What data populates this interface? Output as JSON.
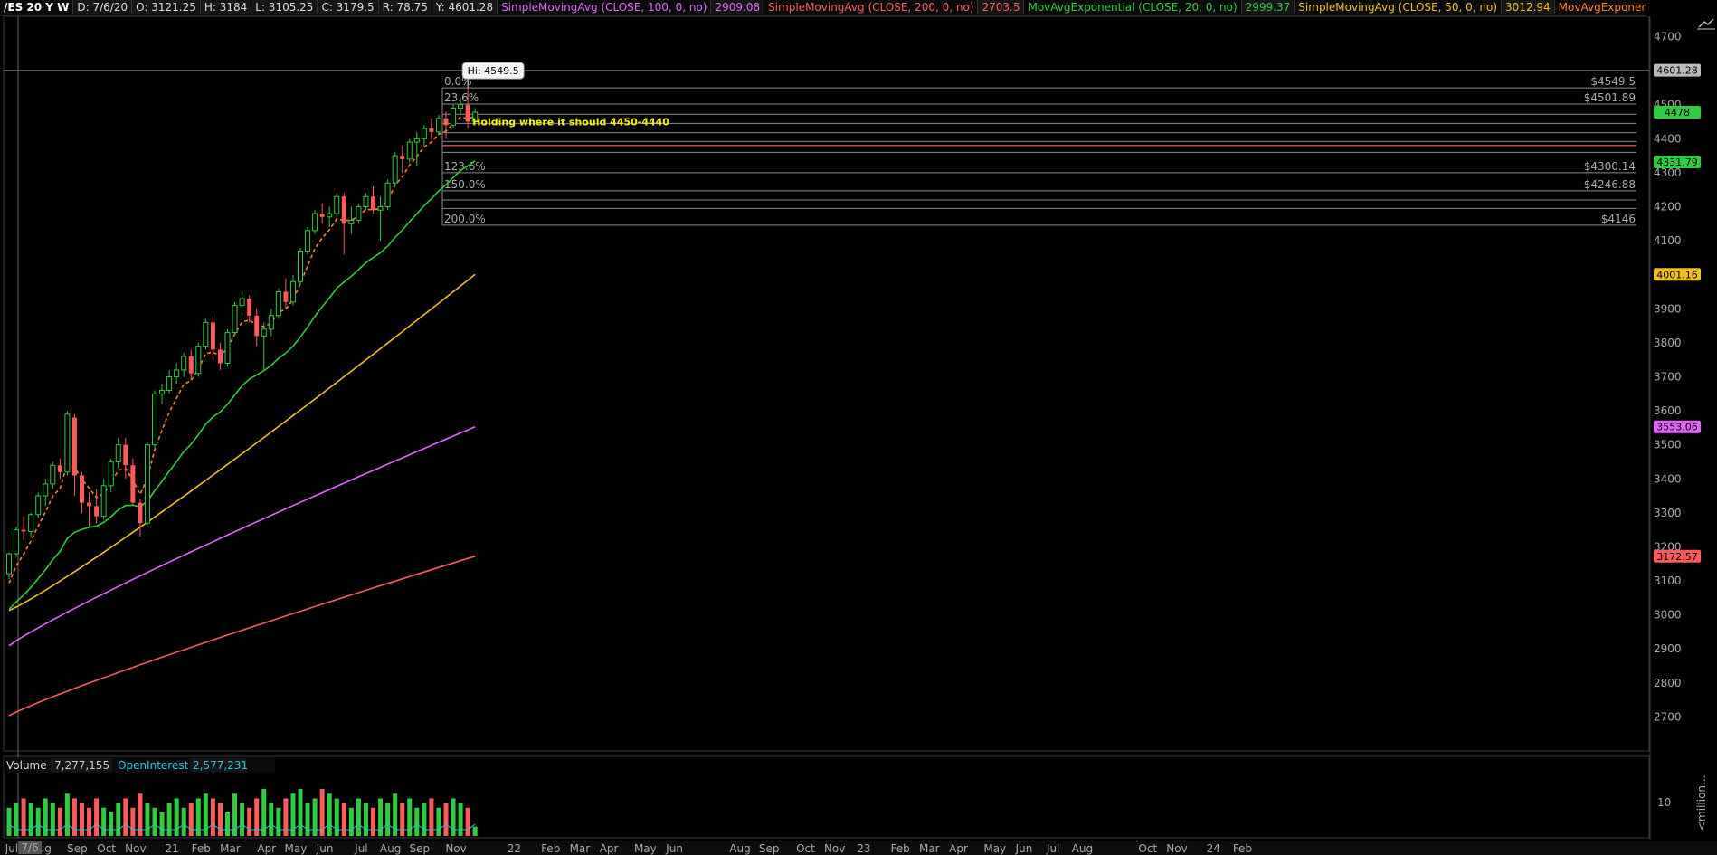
{
  "header": {
    "symbol": "/ES 20 Y W",
    "date": "D: 7/6/20",
    "open": "O: 3121.25",
    "high": "H: 3184",
    "low": "L: 3105.25",
    "close": "C: 3179.5",
    "range": "R: 78.75",
    "y": "Y: 4601.28",
    "studies": [
      {
        "label": "SimpleMovingAvg (CLOSE, 100, 0, no)",
        "value": "2909.08",
        "color": "#e066ff"
      },
      {
        "label": "SimpleMovingAvg (CLOSE, 200, 0, no)",
        "value": "2703.5",
        "color": "#ff5a5a"
      },
      {
        "label": "MovAvgExponential (CLOSE, 20, 0, no)",
        "value": "2999.37",
        "color": "#2ecc40"
      },
      {
        "label": "SimpleMovingAvg (CLOSE, 50, 0, no)",
        "value": "3012.94",
        "color": "#f0c020"
      },
      {
        "label": "MovAvgExponential (CLOSE...",
        "value": "",
        "color": "#ff7f2a"
      }
    ]
  },
  "chart_data": {
    "type": "candlestick",
    "ylim": [
      2600,
      4760
    ],
    "y_ticks": [
      2700,
      2800,
      2900,
      3000,
      3100,
      3200,
      3300,
      3400,
      3500,
      3600,
      3700,
      3800,
      3900,
      4000,
      4100,
      4200,
      4300,
      4400,
      4500,
      4600,
      4700
    ],
    "x_labels": [
      "Jul",
      "Aug",
      "Sep",
      "Oct",
      "Nov",
      "21",
      "Feb",
      "Mar",
      "Apr",
      "May",
      "Jun",
      "Jul",
      "Aug",
      "Sep",
      "Nov",
      "22",
      "Feb",
      "Mar",
      "Apr",
      "May",
      "Jun",
      "Aug",
      "Sep",
      "Oct",
      "Nov",
      "23",
      "Feb",
      "Mar",
      "Apr",
      "May",
      "Jun",
      "Jul",
      "Aug",
      "Oct",
      "Nov",
      "24",
      "Feb"
    ],
    "x_label_index": [
      0,
      4,
      9,
      13,
      17,
      22,
      26,
      30,
      35,
      39,
      43,
      48,
      52,
      56,
      61,
      69,
      74,
      78,
      82,
      87,
      91,
      100,
      104,
      109,
      113,
      117,
      122,
      126,
      130,
      135,
      139,
      143,
      147,
      156,
      160,
      165,
      169
    ],
    "cursor_label": "7/6",
    "candles": [
      [
        3121.25,
        3184,
        3105.25,
        3179.5
      ],
      [
        3180,
        3260,
        3170,
        3250
      ],
      [
        3250,
        3290,
        3220,
        3245
      ],
      [
        3245,
        3300,
        3230,
        3295
      ],
      [
        3295,
        3360,
        3285,
        3350
      ],
      [
        3350,
        3400,
        3320,
        3385
      ],
      [
        3385,
        3450,
        3370,
        3440
      ],
      [
        3440,
        3460,
        3400,
        3420
      ],
      [
        3420,
        3600,
        3410,
        3590
      ],
      [
        3580,
        3590,
        3350,
        3410
      ],
      [
        3410,
        3420,
        3300,
        3330
      ],
      [
        3330,
        3360,
        3260,
        3320
      ],
      [
        3320,
        3370,
        3270,
        3290
      ],
      [
        3290,
        3400,
        3280,
        3380
      ],
      [
        3380,
        3460,
        3360,
        3450
      ],
      [
        3450,
        3520,
        3430,
        3500
      ],
      [
        3500,
        3520,
        3400,
        3440
      ],
      [
        3440,
        3460,
        3320,
        3330
      ],
      [
        3330,
        3340,
        3230,
        3270
      ],
      [
        3270,
        3510,
        3260,
        3500
      ],
      [
        3500,
        3660,
        3490,
        3650
      ],
      [
        3650,
        3680,
        3620,
        3660
      ],
      [
        3660,
        3720,
        3650,
        3700
      ],
      [
        3700,
        3740,
        3680,
        3720
      ],
      [
        3720,
        3770,
        3700,
        3760
      ],
      [
        3760,
        3780,
        3690,
        3710
      ],
      [
        3710,
        3800,
        3700,
        3790
      ],
      [
        3790,
        3870,
        3780,
        3860
      ],
      [
        3860,
        3880,
        3750,
        3780
      ],
      [
        3780,
        3800,
        3720,
        3740
      ],
      [
        3740,
        3840,
        3730,
        3830
      ],
      [
        3830,
        3920,
        3820,
        3910
      ],
      [
        3910,
        3950,
        3880,
        3930
      ],
      [
        3930,
        3940,
        3860,
        3880
      ],
      [
        3880,
        3900,
        3790,
        3820
      ],
      [
        3820,
        3860,
        3720,
        3840
      ],
      [
        3840,
        3900,
        3820,
        3880
      ],
      [
        3880,
        3960,
        3870,
        3950
      ],
      [
        3950,
        3990,
        3900,
        3920
      ],
      [
        3920,
        4000,
        3910,
        3980
      ],
      [
        3980,
        4080,
        3970,
        4070
      ],
      [
        4070,
        4140,
        4060,
        4130
      ],
      [
        4130,
        4190,
        4120,
        4180
      ],
      [
        4180,
        4210,
        4150,
        4170
      ],
      [
        4170,
        4200,
        4140,
        4180
      ],
      [
        4180,
        4240,
        4170,
        4230
      ],
      [
        4230,
        4240,
        4060,
        4150
      ],
      [
        4150,
        4200,
        4120,
        4160
      ],
      [
        4160,
        4210,
        4150,
        4200
      ],
      [
        4200,
        4240,
        4190,
        4230
      ],
      [
        4230,
        4260,
        4180,
        4190
      ],
      [
        4190,
        4230,
        4100,
        4200
      ],
      [
        4200,
        4280,
        4190,
        4270
      ],
      [
        4270,
        4360,
        4260,
        4350
      ],
      [
        4350,
        4380,
        4300,
        4340
      ],
      [
        4340,
        4400,
        4330,
        4390
      ],
      [
        4390,
        4420,
        4320,
        4400
      ],
      [
        4400,
        4440,
        4380,
        4430
      ],
      [
        4430,
        4460,
        4400,
        4420
      ],
      [
        4420,
        4470,
        4410,
        4460
      ],
      [
        4460,
        4480,
        4400,
        4440
      ],
      [
        4440,
        4500,
        4430,
        4490
      ],
      [
        4490,
        4520,
        4470,
        4500
      ],
      [
        4500,
        4549.5,
        4430,
        4450
      ],
      [
        4450,
        4490,
        4445,
        4478
      ]
    ],
    "series": [
      {
        "name": "SimpleMovingAvg (CLOSE, 100, 0, no)",
        "color": "#e066ff",
        "start": 2909,
        "end": 3553.06,
        "curve": 0.9
      },
      {
        "name": "SimpleMovingAvg (CLOSE, 200, 0, no)",
        "color": "#ff5a5a",
        "start": 2703.5,
        "end": 3172.57,
        "curve": 0.9
      },
      {
        "name": "MovAvgExponential (CLOSE, 20, 0, no)",
        "color": "#2ecc40",
        "ema": 20,
        "start": 2999.37
      },
      {
        "name": "SimpleMovingAvg (CLOSE, 50, 0, no)",
        "color": "#f0c020",
        "start": 3012.94,
        "end": 4001.16,
        "curve": 1.1
      },
      {
        "name": "MovAvgExponential (CLOSE...",
        "color": "#ff7f2a",
        "ema": 5,
        "dashed": true,
        "start": 3050
      }
    ],
    "fib": {
      "start_index": 60,
      "levels": [
        {
          "pct": "0.0%",
          "price": "$4549.5",
          "value": 4549.5
        },
        {
          "pct": "23.6%",
          "price": "$4501.89",
          "value": 4501.89
        },
        {
          "pct": "",
          "price": "",
          "value": 4472
        },
        {
          "pct": "",
          "price": "",
          "value": 4445
        },
        {
          "pct": "",
          "price": "",
          "value": 4418
        },
        {
          "pct": "",
          "price": "",
          "value": 4392
        },
        {
          "pct": "",
          "price": "",
          "value": 4360
        },
        {
          "pct": "123.6%",
          "price": "$4300.14",
          "value": 4300.14
        },
        {
          "pct": "150.0%",
          "price": "$4246.88",
          "value": 4246.88
        },
        {
          "pct": "",
          "price": "",
          "value": 4220
        },
        {
          "pct": "",
          "price": "",
          "value": 4195
        },
        {
          "pct": "200.0%",
          "price": "$4146",
          "value": 4146
        }
      ],
      "red_line": 4380
    },
    "hi_label": "Hi: 4549.5",
    "annotation": "Holding where it should 4450-4440",
    "crosshair_value": 4601.28,
    "price_badges": [
      {
        "value": 4601.28,
        "label": "4601.28",
        "color": "#bbbbbb"
      },
      {
        "value": 4478,
        "label": "4478",
        "color": "#2ecc40"
      },
      {
        "value": 4331.79,
        "label": "4331.79",
        "color": "#2ecc40"
      },
      {
        "value": 4001.16,
        "label": "4001.16",
        "color": "#f0c020"
      },
      {
        "value": 3553.06,
        "label": "3553.06",
        "color": "#e066ff"
      },
      {
        "value": 3172.57,
        "label": "3172.57",
        "color": "#ff5a5a"
      }
    ]
  },
  "volume_panel": {
    "label": "Volume",
    "volume": "7,277,155",
    "oi_label": "OpenInterest",
    "oi": "2,577,231",
    "scale_label": "10",
    "unit_label": "<million...",
    "bars": [
      6,
      7,
      8,
      7,
      6,
      8,
      7,
      6,
      9,
      8,
      7,
      6,
      8,
      6,
      5,
      7,
      8,
      6,
      9,
      7,
      6,
      5,
      7,
      8,
      6,
      7,
      8,
      9,
      8,
      7,
      5,
      9,
      7,
      6,
      8,
      10,
      7,
      6,
      8,
      9,
      10,
      7,
      8,
      10,
      9,
      8,
      7,
      6,
      8,
      7,
      6,
      8,
      7,
      9,
      7,
      8,
      6,
      7,
      8,
      6,
      7,
      8,
      7,
      6,
      2
    ]
  }
}
